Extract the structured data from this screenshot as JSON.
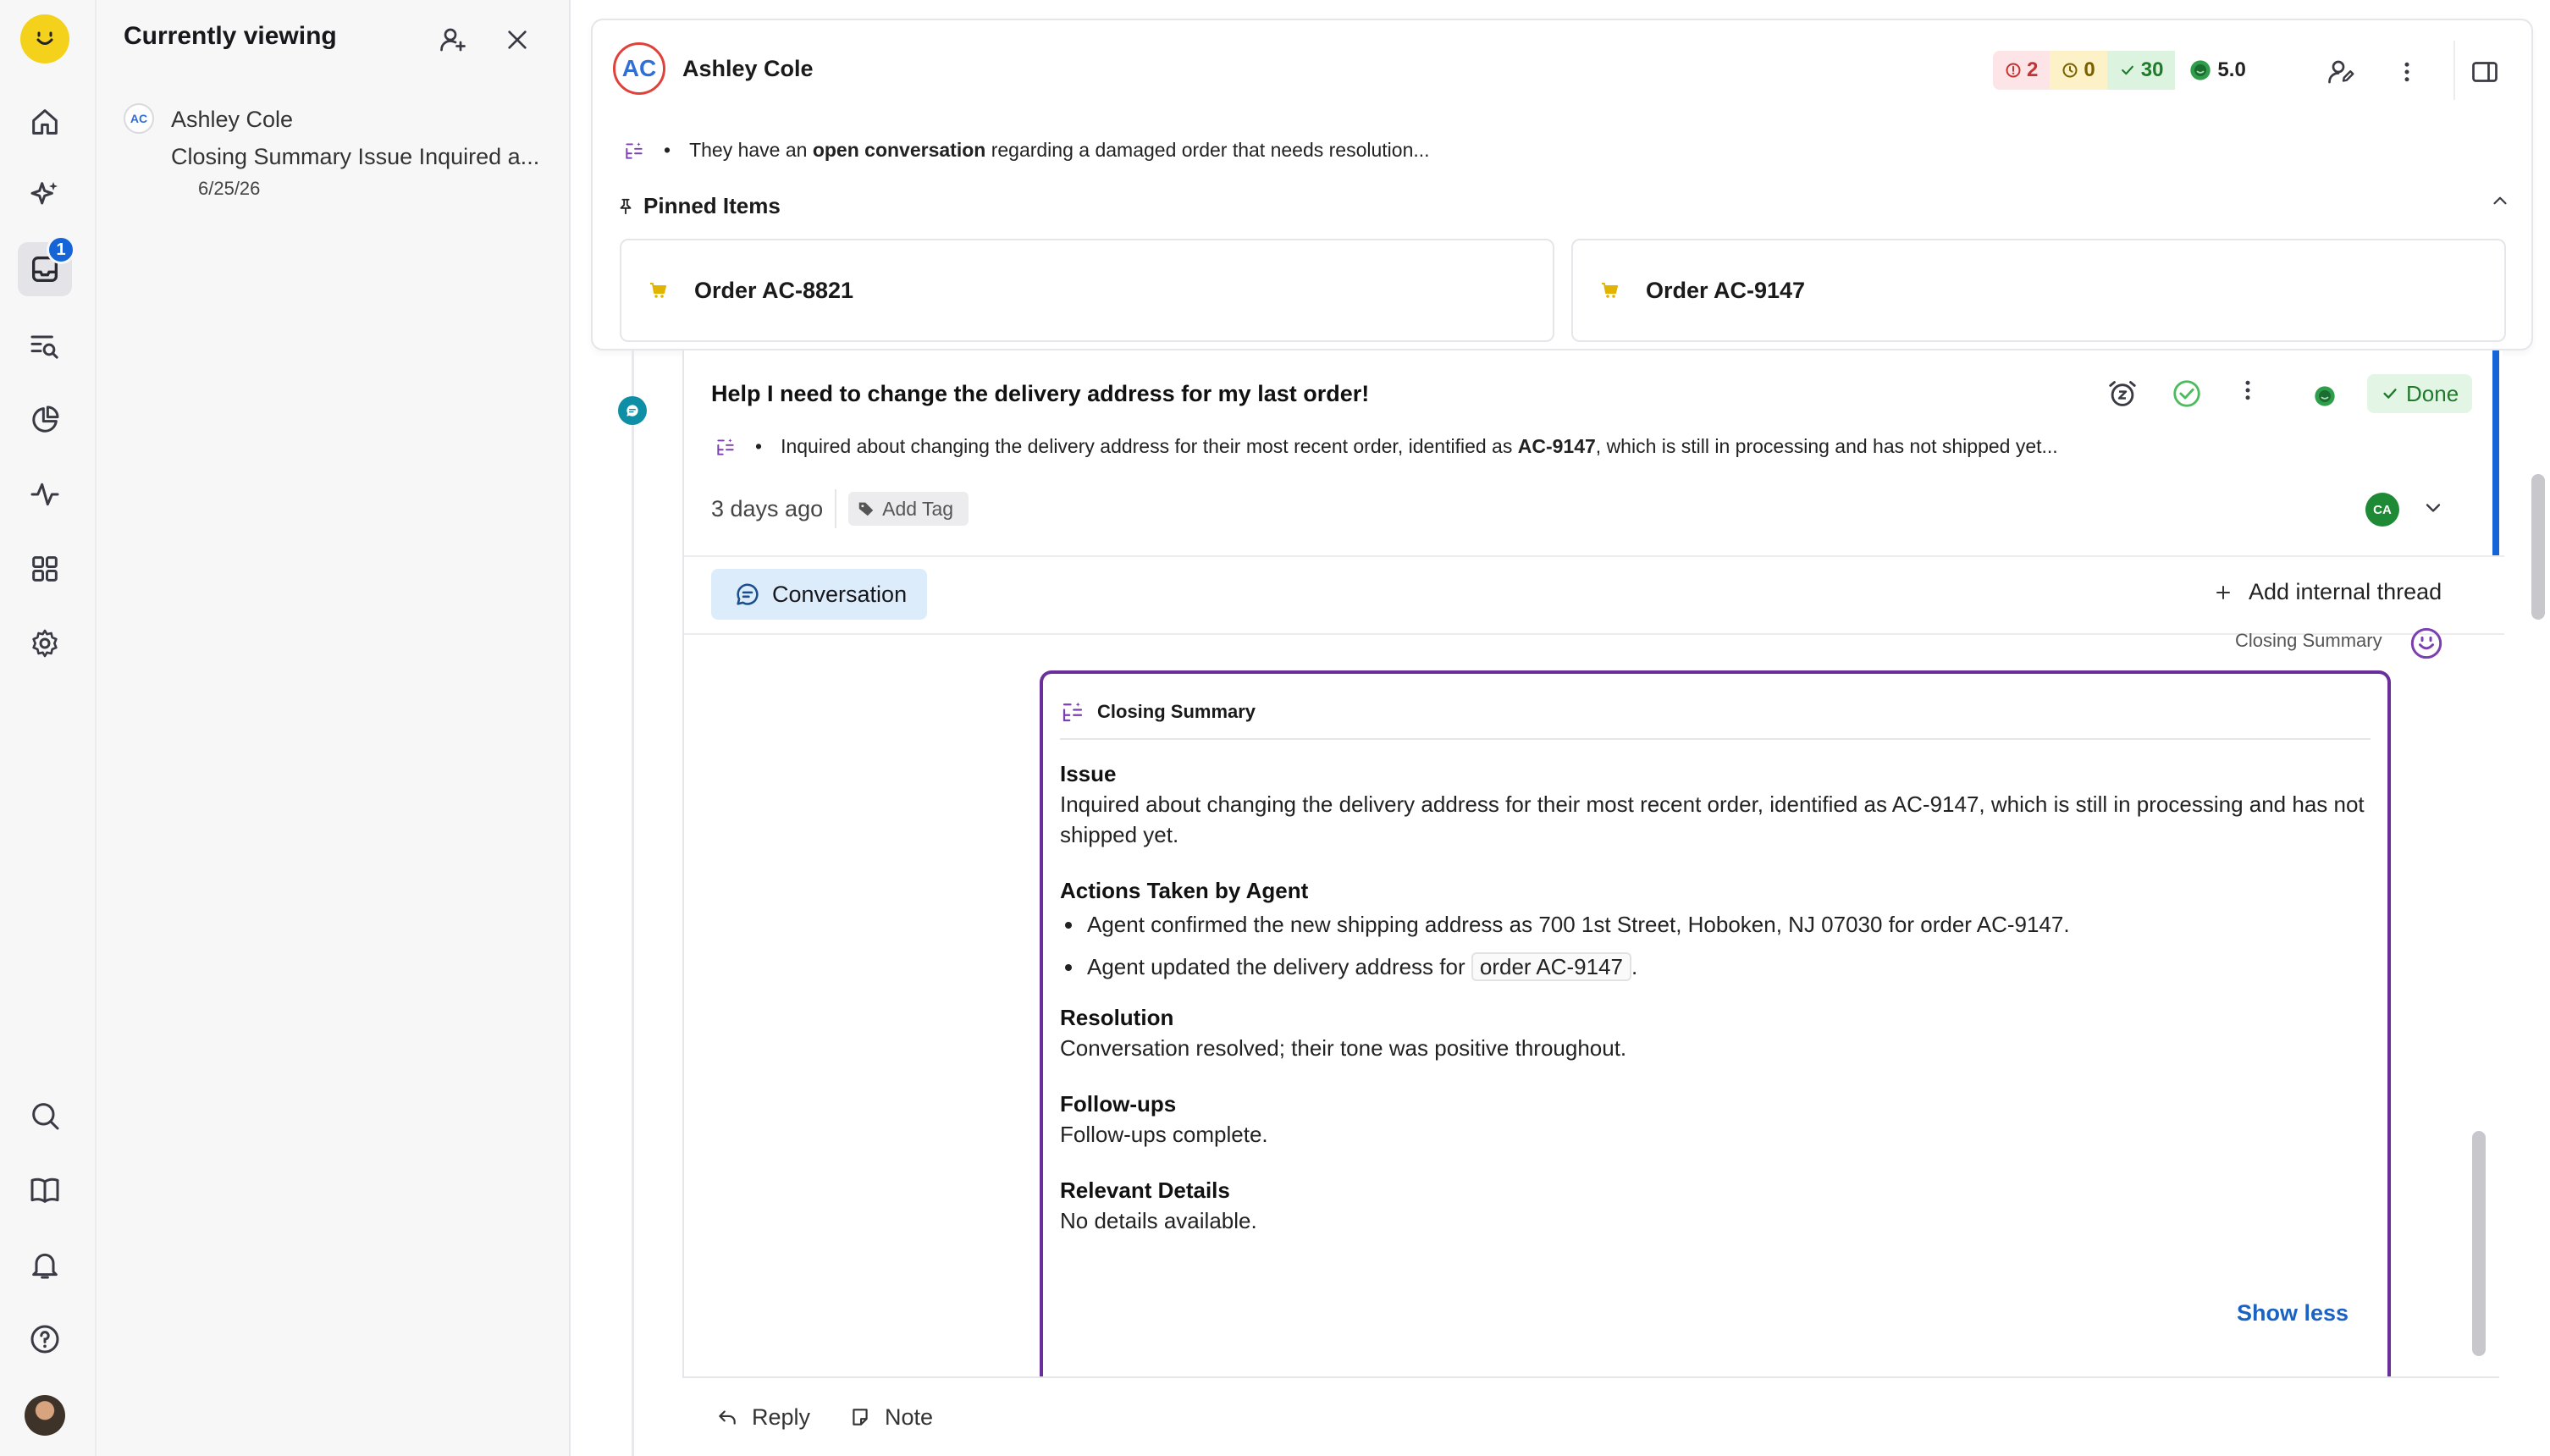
{
  "colors": {
    "accent": "#1565d8",
    "brand": "#f4d21c",
    "summary_border": "#6a2f9a",
    "done": "#1f7a2c"
  },
  "rail": {
    "inbox_badge": "1",
    "items": [
      "home-icon",
      "sparkles-icon",
      "inbox-icon",
      "search-list-icon",
      "pie-chart-icon",
      "activity-icon",
      "apps-grid-icon",
      "settings-icon"
    ],
    "bottom_items": [
      "search-icon",
      "book-icon",
      "bell-icon",
      "help-icon"
    ]
  },
  "currently_viewing": {
    "title": "Currently viewing",
    "item": {
      "initials": "AC",
      "name": "Ashley Cole",
      "subject": "Closing Summary Issue Inquired a...",
      "date": "6/25/26"
    }
  },
  "header": {
    "initials": "AC",
    "name": "Ashley Cole",
    "stats": {
      "alerts": "2",
      "warnings": "0",
      "resolved": "30",
      "score": "5.0"
    },
    "summary_pre": "They have an ",
    "summary_bold": "open conversation",
    "summary_post": " regarding a damaged order that needs resolution...",
    "pinned_title": "Pinned Items",
    "pinned": [
      {
        "label": "Order AC-8821"
      },
      {
        "label": "Order AC-9147"
      }
    ]
  },
  "conversation": {
    "title": "Help I need to change the delivery address for my last order!",
    "status": "Done",
    "summary_pre": "Inquired about changing the delivery address for their most recent order, identified as ",
    "summary_bold": "AC-9147",
    "summary_post": ", which is still in processing and has not shipped yet...",
    "age": "3 days ago",
    "add_tag": "Add Tag",
    "assignee_initials": "CA",
    "tab_label": "Conversation",
    "add_thread": "Add internal thread"
  },
  "closing_summary": {
    "label": "Closing Summary",
    "title": "Closing Summary",
    "issue_h": "Issue",
    "issue_text": "Inquired about changing the delivery address for their most recent order, identified as AC-9147, which is still in processing and has not shipped yet.",
    "actions_h": "Actions Taken by Agent",
    "action_1": "Agent confirmed the new shipping address as 700 1st Street, Hoboken, NJ 07030 for order AC-9147.",
    "action_2_pre": "Agent updated the delivery address for ",
    "action_2_code": "order AC-9147",
    "action_2_post": ".",
    "resolution_h": "Resolution",
    "resolution_text": "Conversation resolved; their tone was positive throughout.",
    "followups_h": "Follow-ups",
    "followups_text": "Follow-ups complete.",
    "details_h": "Relevant Details",
    "details_text": "No details available.",
    "show_less": "Show less"
  },
  "composer": {
    "reply": "Reply",
    "note": "Note"
  }
}
